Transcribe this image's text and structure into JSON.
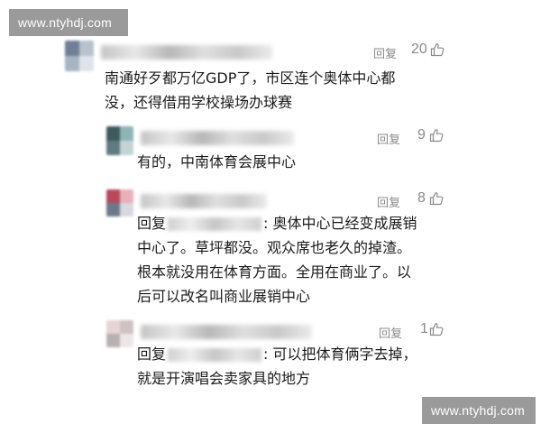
{
  "watermark": {
    "top_text": "www.ntyhdj.com",
    "bottom_text": "www.ntyhdj.com"
  },
  "reply_label": "回复",
  "icons": {
    "like": "thumbs-up-icon"
  },
  "comments": [
    {
      "likes": "20",
      "lines": [
        "南通好歹都万亿GDP了，市区连个奥体中心都",
        "没，还得借用学校操场办球赛"
      ]
    },
    {
      "likes": "9",
      "lines": [
        "有的，中南体育会展中心"
      ]
    },
    {
      "likes": "8",
      "reply_prefix": "回复",
      "lines": [
        ": 奥体中心已经变成展销",
        "中心了。草坪都没。观众席也老久的掉渣。",
        "根本就没用在体育方面。全用在商业了。以",
        "后可以改名叫商业展销中心"
      ]
    },
    {
      "likes": "1",
      "reply_prefix": "回复",
      "lines": [
        ": 可以把体育俩字去掉，",
        "就是开演唱会卖家具的地方"
      ]
    }
  ]
}
